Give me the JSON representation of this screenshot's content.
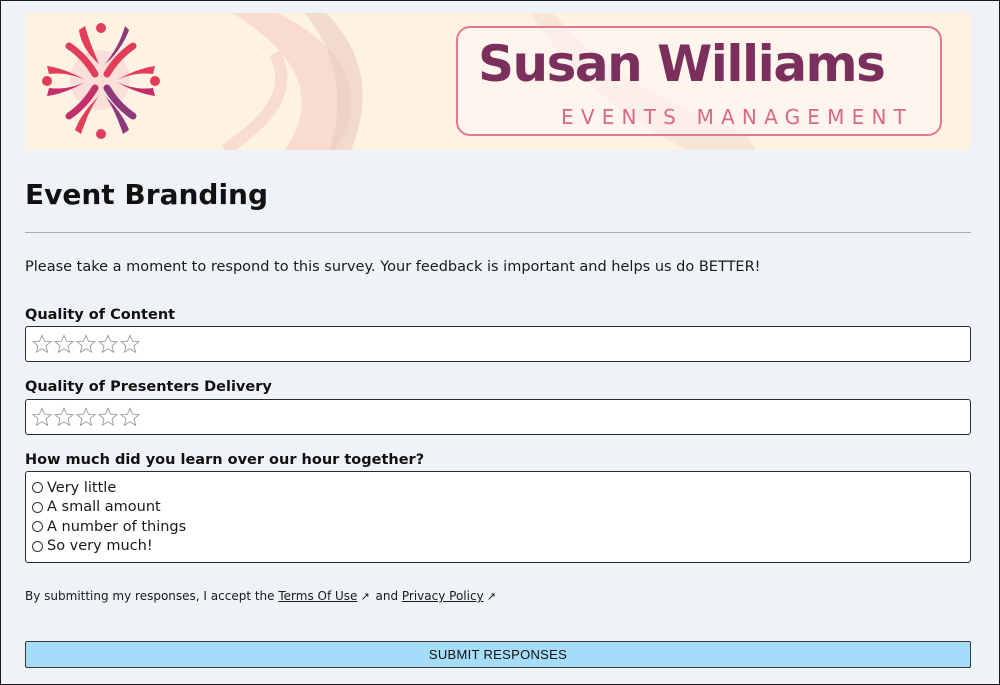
{
  "banner": {
    "brand_name": "Susan Williams",
    "brand_subtitle": "EVENTS MANAGEMENT",
    "logo_icon": "flower-petals-logo-icon",
    "colors": {
      "background": "#fef3e2",
      "brand_purple": "#7a2f5d",
      "brand_pink": "#e07a92",
      "logo_red": "#e23e5a"
    }
  },
  "page": {
    "title": "Event Branding",
    "intro": "Please take a moment to respond to this survey. Your feedback is important and helps us do BETTER!"
  },
  "questions": [
    {
      "label": "Quality of Content",
      "type": "star-rating",
      "max_stars": 5,
      "rating": 0
    },
    {
      "label": "Quality of Presenters Delivery",
      "type": "star-rating",
      "max_stars": 5,
      "rating": 0
    },
    {
      "label": "How much did you learn over our hour together?",
      "type": "radio",
      "options": [
        "Very little",
        "A small amount",
        "A number of things",
        "So very much!"
      ],
      "selected": null
    }
  ],
  "consent": {
    "prefix": "By submitting my responses, I accept the",
    "terms_label": "Terms Of Use",
    "conjunction": "and",
    "privacy_label": "Privacy Policy",
    "external_icon": "external-link-icon"
  },
  "submit": {
    "label": "SUBMIT RESPONSES",
    "color": "#a5dcf9"
  }
}
